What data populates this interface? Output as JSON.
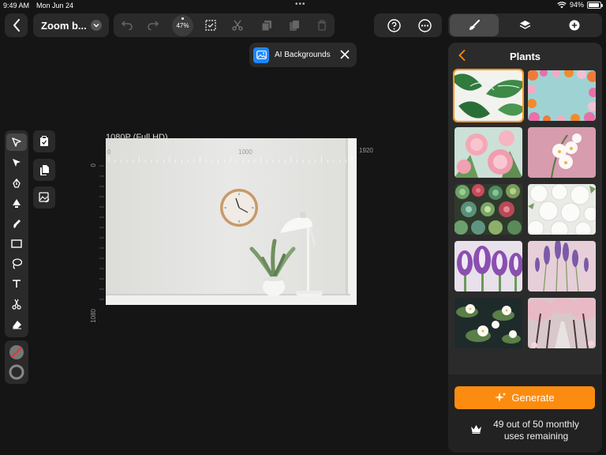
{
  "status_bar": {
    "time": "9:49 AM",
    "date": "Mon Jun 24",
    "battery": "94%",
    "battery_level": 0.94
  },
  "toolbar": {
    "document_title": "Zoom b...",
    "zoom_level": "47%"
  },
  "ai_chip": {
    "label": "AI Backgrounds"
  },
  "canvas": {
    "resolution_label": "1080P (Full HD)",
    "ruler_h_start": "0",
    "ruler_h_mid": "1000",
    "ruler_h_end": "1920",
    "ruler_v_start": "0",
    "ruler_v_end": "1080"
  },
  "panel": {
    "title": "Plants",
    "thumbnails": [
      {
        "name": "monstera-leaves",
        "selected": true
      },
      {
        "name": "flower-frame",
        "selected": false
      },
      {
        "name": "pink-peonies",
        "selected": false
      },
      {
        "name": "white-orchids",
        "selected": false
      },
      {
        "name": "succulents",
        "selected": false
      },
      {
        "name": "white-roses",
        "selected": false
      },
      {
        "name": "purple-tulips",
        "selected": false
      },
      {
        "name": "lavender",
        "selected": false
      },
      {
        "name": "water-lilies",
        "selected": false
      },
      {
        "name": "cherry-blossom-path",
        "selected": false
      }
    ],
    "generate_label": "Generate",
    "uses_line1": "49 out of 50 monthly",
    "uses_line2": "uses remaining"
  },
  "colors": {
    "accent": "#fb8c10",
    "selection": "#ff9a1a",
    "chip_icon": "#1e86ff",
    "panel_bg": "#2b2b2b"
  }
}
